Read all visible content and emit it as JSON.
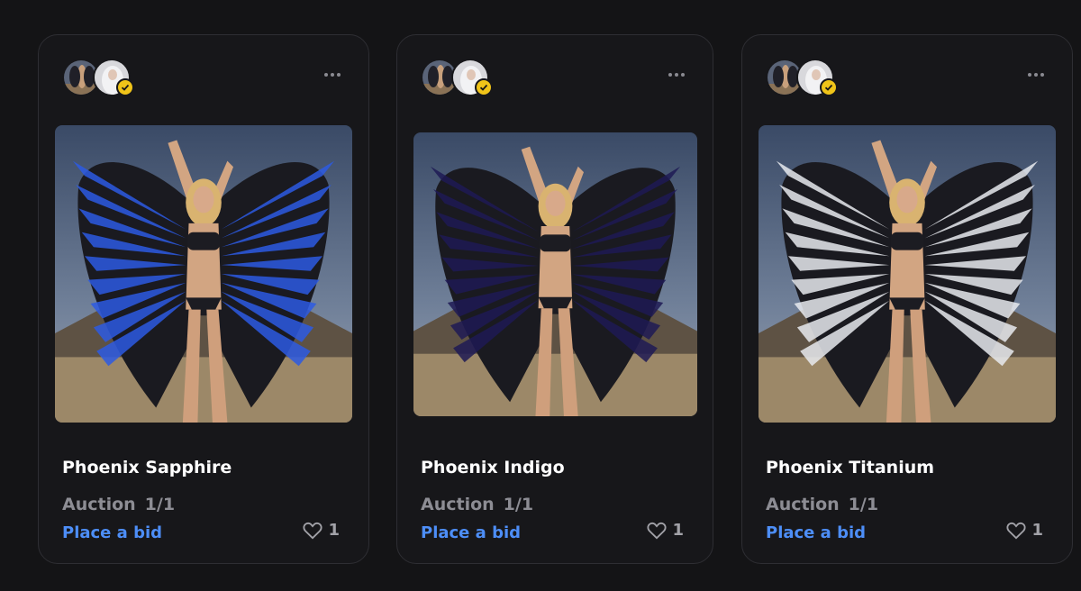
{
  "cards": [
    {
      "title": "Phoenix Sapphire",
      "edition_label": "Auction",
      "edition_count": "1/1",
      "action_label": "Place a bid",
      "likes": "1",
      "wing_color": "#2d5be3",
      "verified_icon": "check-badge-icon"
    },
    {
      "title": "Phoenix Indigo",
      "edition_label": "Auction",
      "edition_count": "1/1",
      "action_label": "Place a bid",
      "likes": "1",
      "wing_color": "#1f1a55",
      "verified_icon": "check-badge-icon"
    },
    {
      "title": "Phoenix Titanium",
      "edition_label": "Auction",
      "edition_count": "1/1",
      "action_label": "Place a bid",
      "likes": "1",
      "wing_color": "#e8eaee",
      "verified_icon": "check-badge-icon"
    }
  ],
  "colors": {
    "background": "#141416",
    "card": "#17171a",
    "accent": "#4d8ef7",
    "verified": "#f0c419"
  }
}
